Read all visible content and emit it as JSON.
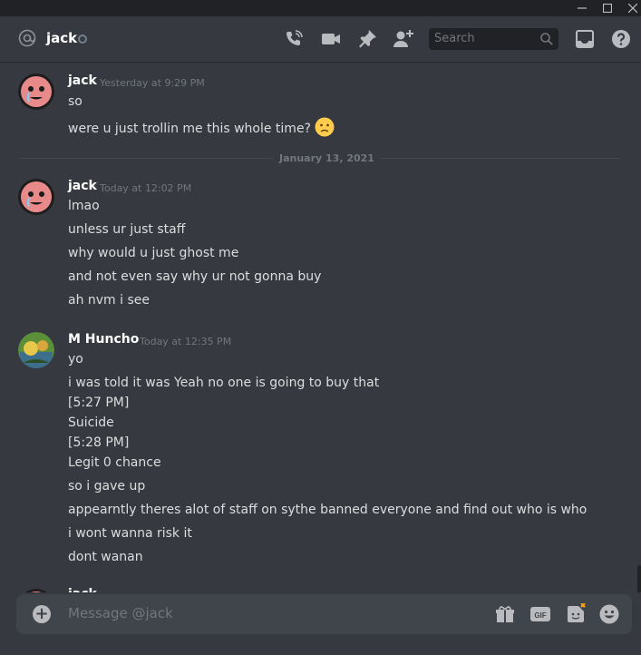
{
  "header": {
    "user_name": "jack",
    "search_placeholder": "Search"
  },
  "messages": [
    {
      "author": "jack",
      "timestamp": "Yesterday at 9:29 PM",
      "lines": [
        "so",
        "were u just trollin me this whole time?"
      ]
    },
    {
      "divider": "January 13, 2021"
    },
    {
      "author": "jack",
      "timestamp": "Today at 12:02 PM",
      "lines": [
        "lmao",
        "unless ur just staff",
        "why would u just ghost me",
        "and not even say why ur not gonna buy",
        "ah nvm i see"
      ]
    },
    {
      "author": "M Huncho",
      "timestamp": "Today at 12:35 PM",
      "lines": [
        "yo",
        "i was told it was Yeah no one is going to buy that",
        "[5:27 PM]",
        "Suicide",
        "[5:28 PM]",
        "Legit 0 chance",
        "so i gave up",
        "appearntly theres alot of staff on sythe banned everyone and find out who is who",
        "i wont wanna risk it",
        "dont wanan"
      ]
    },
    {
      "author": "jack",
      "timestamp": "",
      "lines": []
    }
  ],
  "composer": {
    "placeholder": "Message @jack"
  },
  "colors": {
    "background": "#36393f",
    "titlebar": "#202225",
    "composer": "#40444b",
    "text": "#dcddde",
    "muted": "#72767d"
  }
}
